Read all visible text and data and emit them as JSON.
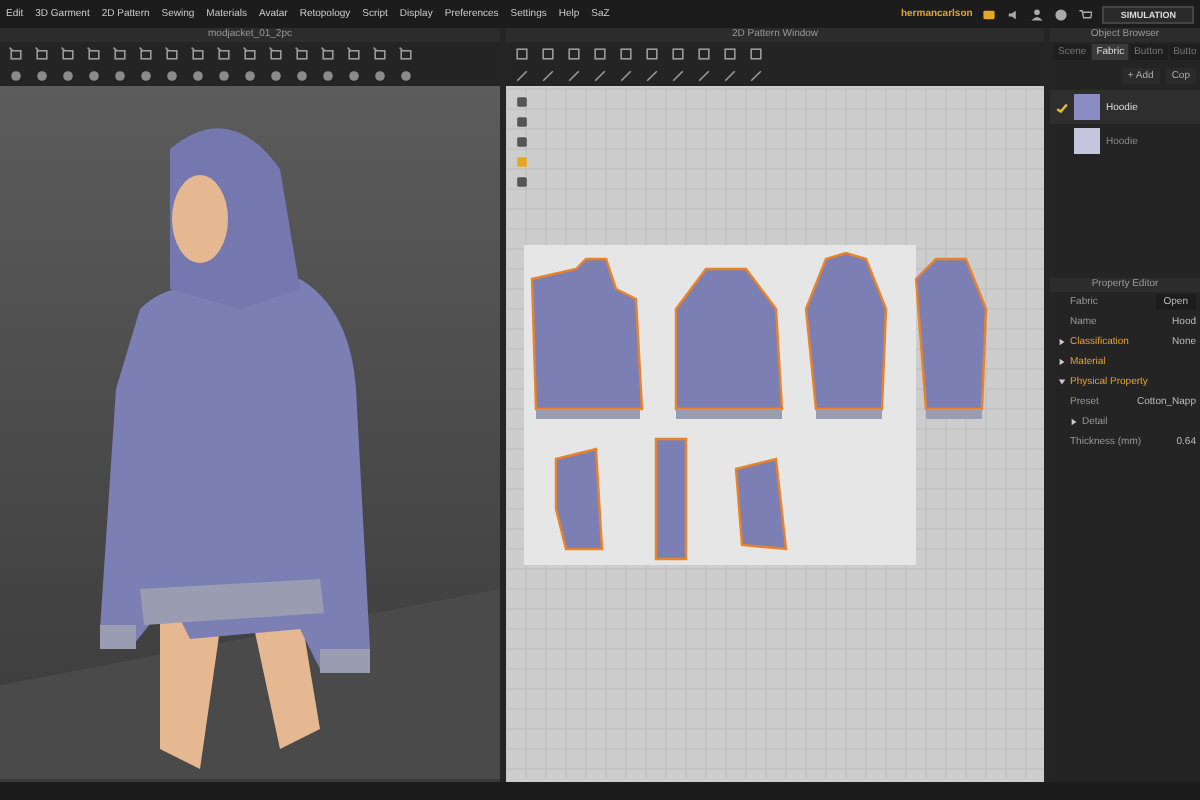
{
  "menu": [
    "Edit",
    "3D Garment",
    "2D Pattern",
    "Sewing",
    "Materials",
    "Avatar",
    "Retopology",
    "Script",
    "Display",
    "Preferences",
    "Settings",
    "Help",
    "SaZ"
  ],
  "account": {
    "user": "hermancarlson"
  },
  "simulation_button": "SIMULATION",
  "viewport_3d": {
    "title": "modjacket_01_2pc"
  },
  "pattern_window": {
    "title": "2D Pattern Window"
  },
  "object_browser": {
    "title": "Object Browser",
    "tabs": [
      {
        "label": "Scene",
        "selected": false
      },
      {
        "label": "Fabric",
        "selected": true
      },
      {
        "label": "Button",
        "selected": false
      },
      {
        "label": "Butto",
        "selected": false
      }
    ],
    "actions": [
      "+ Add",
      "Cop"
    ],
    "fabrics": [
      {
        "name": "Hoodie",
        "selected": true,
        "color": "#8a8cc4"
      },
      {
        "name": "Hoodie",
        "selected": false,
        "color": "#c4c6dc"
      }
    ]
  },
  "property_editor": {
    "title": "Property Editor",
    "rows": [
      {
        "kind": "field",
        "label": "Fabric",
        "value": "Open"
      },
      {
        "kind": "field",
        "label": "Name",
        "value": "Hood"
      },
      {
        "kind": "group",
        "label": "Classification",
        "value": "None",
        "expanded": false
      },
      {
        "kind": "group",
        "label": "Material",
        "expanded": false
      },
      {
        "kind": "group",
        "label": "Physical Property",
        "expanded": true
      },
      {
        "kind": "field",
        "label": "Preset",
        "value": "Cotton_Napp"
      },
      {
        "kind": "subgroup",
        "label": "Detail",
        "expanded": false
      },
      {
        "kind": "field",
        "label": "Thickness (mm)",
        "value": "0.64"
      }
    ]
  }
}
